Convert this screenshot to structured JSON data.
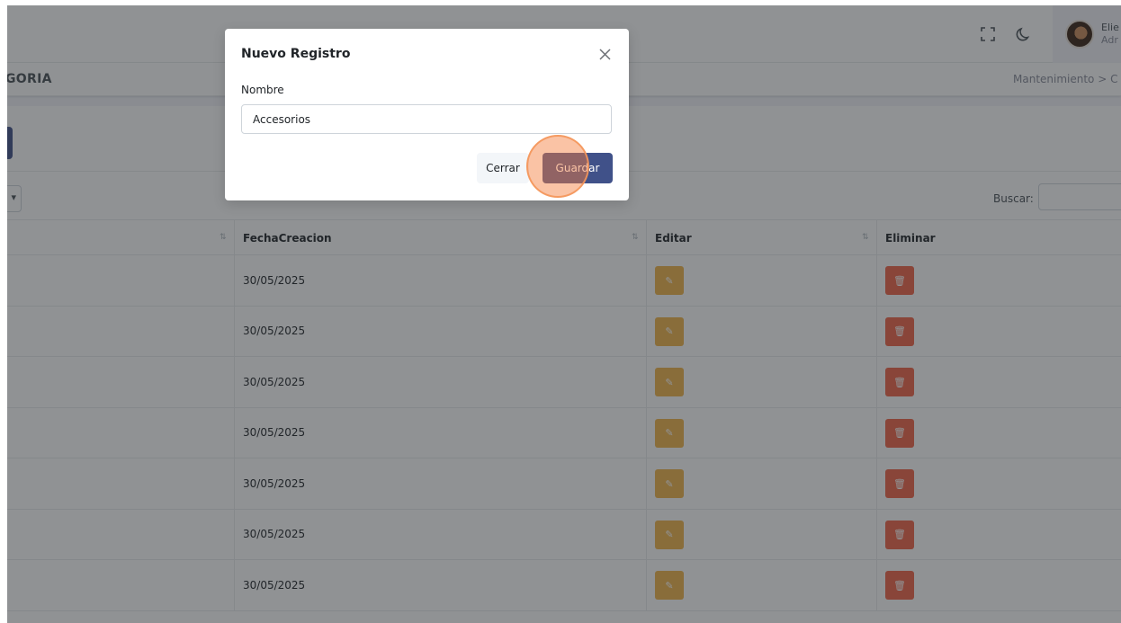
{
  "header": {
    "user_name": "Elie",
    "user_role": "Adr"
  },
  "page": {
    "title": "GORIA",
    "breadcrumb": "Mantenimiento  >  C"
  },
  "list": {
    "search_label": "Buscar:"
  },
  "table": {
    "columns": [
      "FechaCreacion",
      "Editar",
      "Eliminar"
    ],
    "rows": [
      {
        "fecha": "30/05/2025"
      },
      {
        "fecha": "30/05/2025"
      },
      {
        "fecha": "30/05/2025"
      },
      {
        "fecha": "30/05/2025"
      },
      {
        "fecha": "30/05/2025"
      },
      {
        "fecha": "30/05/2025"
      },
      {
        "fecha": "30/05/2025"
      }
    ]
  },
  "modal": {
    "title": "Nuevo Registro",
    "field_label": "Nombre",
    "field_value": "Accesorios",
    "cancel_label": "Cerrar",
    "save_label": "Guardar"
  },
  "colors": {
    "primary": "#405189",
    "edit": "#f0b44b",
    "delete": "#f06548",
    "click_highlight": "#f47938"
  },
  "icons": {
    "fullscreen": "fullscreen-icon",
    "theme": "moon-icon",
    "close": "close-icon",
    "edit": "pencil-icon",
    "delete": "trash-icon",
    "sort": "sort-icon"
  }
}
